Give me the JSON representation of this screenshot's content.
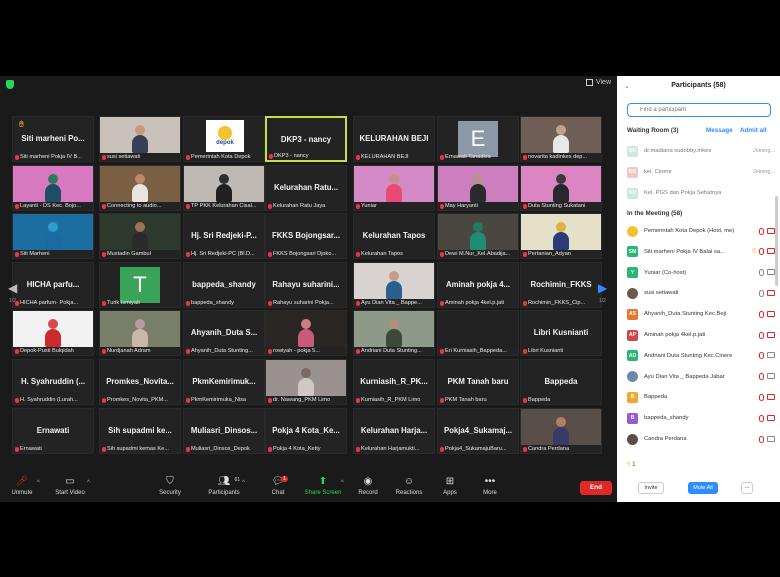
{
  "window": {
    "view_label": "View"
  },
  "tiles": [
    {
      "name": "Siti marheni Po...",
      "label": "Siti marheni Pokja IV B...",
      "style": "text",
      "hand": true
    },
    {
      "name": "",
      "label": "susi setiawati",
      "style": "video",
      "bg": "#c9c2bb",
      "skin": "#c89a78",
      "cloth": "#3a3f57"
    },
    {
      "name": "",
      "label": "Pemerintah Kota Depok",
      "style": "logo"
    },
    {
      "name": "DKP3 - nancy",
      "label": "DKP3 - nancy",
      "style": "text",
      "active": true
    },
    {
      "name": "KELURAHAN BEJI",
      "label": "KELURAHAN BEJI",
      "style": "text"
    },
    {
      "name": "E",
      "label": "Ernawati Tanadiva",
      "style": "letter",
      "letterbg": "#8c98a6"
    },
    {
      "name": "",
      "label": "novarita kadinkes dep...",
      "style": "video",
      "bg": "#6f5f56",
      "skin": "#c4a08a",
      "cloth": "#e8e8e8"
    },
    {
      "name": "",
      "label": "Layanti - DS Kec. Bojo...",
      "style": "video",
      "bg": "#d879c0",
      "skin": "#2a7a60",
      "cloth": "#1e4e66"
    },
    {
      "name": "",
      "label": "Connecting to audio...",
      "style": "video",
      "bg": "#7a5f44",
      "skin": "#b88a68",
      "cloth": "#e9e4de"
    },
    {
      "name": "",
      "label": "TP PKK Kelurahan Cisal...",
      "style": "video",
      "bg": "#bfb9b3",
      "skin": "#2d2d2d",
      "cloth": "#202020"
    },
    {
      "name": "Kelurahan Ratu...",
      "label": "Kelurahan Ratu Jaya",
      "style": "text"
    },
    {
      "name": "",
      "label": "Yuniar",
      "style": "video",
      "bg": "#d58ac8",
      "skin": "#c8918b",
      "cloth": "#e94a75"
    },
    {
      "name": "",
      "label": "May Haryanti",
      "style": "video",
      "bg": "#cc7ebf",
      "skin": "#b8928a",
      "cloth": "#2b2b2b"
    },
    {
      "name": "",
      "label": "Duta Stunting Sukatani",
      "style": "video",
      "bg": "#dc85c4",
      "skin": "#3a3a3a",
      "cloth": "#27272f"
    },
    {
      "name": "",
      "label": "Siti Marheni",
      "style": "video",
      "bg": "#1d6ea0",
      "skin": "#2f9cd0",
      "cloth": "#1b6aa3"
    },
    {
      "name": "",
      "label": "Mustadin Gambul",
      "style": "video",
      "bg": "#2d3a2d",
      "skin": "#9a7356",
      "cloth": "#2b2b2b"
    },
    {
      "name": "Hj. Sri Redjeki-P...",
      "label": "Hj. Sri Redjeki-PC (Bl.D...",
      "style": "text"
    },
    {
      "name": "FKKS Bojongsar...",
      "label": "FKKS Bojongsari Djoko...",
      "style": "text"
    },
    {
      "name": "Kelurahan Tapos",
      "label": "Kelurahan Tapos",
      "style": "text"
    },
    {
      "name": "",
      "label": "Dewi M.Nur_Kel.Abadija...",
      "style": "video",
      "bg": "#4a4640",
      "skin": "#1f7a66",
      "cloth": "#1f8c74"
    },
    {
      "name": "",
      "label": "Pertanian_Adyan",
      "style": "video",
      "bg": "#e6e0c8",
      "skin": "#d9b240",
      "cloth": "#2b3b7a"
    },
    {
      "name": "HICHA parfu...",
      "label": "HICHA parfum- Pokja...",
      "style": "text"
    },
    {
      "name": "T",
      "label": "Turik Ismiyati",
      "style": "letter",
      "letterbg": "#3aa35a"
    },
    {
      "name": "bappeda_shandy",
      "label": "bappeda_shandy",
      "style": "text"
    },
    {
      "name": "Rahayu suharini...",
      "label": "Rahayu suharini Pokja...",
      "style": "text"
    },
    {
      "name": "",
      "label": "Ayu Dian Vita _ Bappe...",
      "style": "video",
      "bg": "#d8d3d1",
      "skin": "#c89a88",
      "cloth": "#2a6090"
    },
    {
      "name": "Aminah pokja 4...",
      "label": "Aminah pokja 4kel.p.jati",
      "style": "text"
    },
    {
      "name": "Rochimin_FKKS",
      "label": "Rochimin_FKKS_Cip...",
      "style": "text"
    },
    {
      "name": "",
      "label": "Depok-Pusti Bulqidah",
      "style": "video",
      "bg": "#f2f2f2",
      "skin": "#d44a4a",
      "cloth": "#cc2b2b"
    },
    {
      "name": "",
      "label": "Nurdjanah Adram",
      "style": "video",
      "bg": "#7a7f6a",
      "skin": "#b89ca0",
      "cloth": "#c9b8a8"
    },
    {
      "name": "Ahyanih_Duta S...",
      "label": "Ahyanih_Duta Stunting...",
      "style": "text"
    },
    {
      "name": "",
      "label": "rowiyah - pokja 5...",
      "style": "video",
      "bg": "#2a2624",
      "skin": "#d27a8a",
      "cloth": "#c85a7a"
    },
    {
      "name": "",
      "label": "Andriani Duta Stunting...",
      "style": "video",
      "bg": "#8d9a8a",
      "skin": "#b0907a",
      "cloth": "#3a4a3a"
    },
    {
      "name": "",
      "label": "Eri Kurniasih_Bappeda...",
      "style": "video",
      "bg": "#212121",
      "skin": "#212121",
      "cloth": "#212121"
    },
    {
      "name": "Libri Kusnianti",
      "label": "Libri Kusnianti",
      "style": "text"
    },
    {
      "name": "H. Syahruddin (...",
      "label": "H. Syahruddin (Lurah...",
      "style": "text"
    },
    {
      "name": "Promkes_Novita...",
      "label": "Promkes_Novita_PKM...",
      "style": "text"
    },
    {
      "name": "PkmKemirimuk...",
      "label": "PkmKemirimuka_Nisa",
      "style": "text"
    },
    {
      "name": "",
      "label": "dr. Nawang_PKM Limo",
      "style": "video",
      "bg": "#9a9290",
      "skin": "#7a6a66",
      "cloth": "#cfc8c4"
    },
    {
      "name": "Kurniasih_R_PK...",
      "label": "Kurniasih_R_PKM Limo",
      "style": "text"
    },
    {
      "name": "PKM Tanah baru",
      "label": "PKM Tanah baru",
      "style": "text"
    },
    {
      "name": "Bappeda",
      "label": "Bappeda",
      "style": "text"
    },
    {
      "name": "Ernawati",
      "label": "Ernawati",
      "style": "text"
    },
    {
      "name": "Sih supadmi ke...",
      "label": "Sih supadmi kemas Ke...",
      "style": "text"
    },
    {
      "name": "Muliasri_Dinsos...",
      "label": "Muliasri_Dinsos_Depok",
      "style": "text"
    },
    {
      "name": "Pokja 4 Kota_Ke...",
      "label": "Pokja 4 Kota_Ketty",
      "style": "text"
    },
    {
      "name": "Kelurahan Harja...",
      "label": "Kelurahan Harjamukti...",
      "style": "text"
    },
    {
      "name": "Pokja4_Sukamaj...",
      "label": "Pokja4_SukamajuBaru...",
      "style": "text"
    },
    {
      "name": "",
      "label": "Candra Perdana",
      "style": "video",
      "bg": "#5a4f48",
      "skin": "#b08062",
      "cloth": "#3a3a6a"
    }
  ],
  "logo_text": "depok",
  "page": {
    "left": "1/2",
    "right": "1/2"
  },
  "toolbar": {
    "unmute": "Unmute",
    "start_video": "Start Video",
    "security": "Security",
    "participants": "Participants",
    "participants_count": "61",
    "chat": "Chat",
    "chat_badge": "1",
    "share_screen": "Share Screen",
    "record": "Record",
    "reactions": "Reactions",
    "apps": "Apps",
    "more": "More",
    "end": "End"
  },
  "panel": {
    "title": "Participants (58)",
    "search_placeholder": "Find a participant",
    "waiting_room": "Waiting Room (3)",
    "message": "Message",
    "admit_all": "Admit all",
    "waiting": [
      {
        "initials": "DR",
        "name": "dr.madiana sudobby.mkes",
        "status": "Joining...",
        "color": "#cfe8d8"
      },
      {
        "initials": "KC",
        "name": "kel. Cinere",
        "status": "Joining...",
        "color": "#f1c7c7"
      },
      {
        "initials": "KP",
        "name": "Kel. PGS dan Pokja Sehatnya",
        "status": "",
        "color": "#cfe8d8"
      }
    ],
    "in_meeting": "In the Meeting (58)",
    "members": [
      {
        "initials": "",
        "name": "Pemerintah Kota Depok (Host, me)",
        "color": "#f2c230",
        "mic": "muted",
        "cam": "off",
        "hand": false,
        "photo": true
      },
      {
        "initials": "SM",
        "name": "Siti marheni Pokja IV Balai sa...",
        "color": "#2bb673",
        "mic": "muted",
        "cam": "off",
        "hand": true
      },
      {
        "initials": "Y",
        "name": "Yuniar (Co-host)",
        "color": "#2bb673",
        "mic": "on",
        "cam": "on",
        "hand": false
      },
      {
        "initials": "",
        "name": "susi setiawati",
        "color": "#6a5a4a",
        "mic": "on",
        "cam": "off",
        "hand": false,
        "photo": true
      },
      {
        "initials": "AS",
        "name": "Ahyanih_Duta Stunting Kec.Beji",
        "color": "#e8772e",
        "mic": "muted",
        "cam": "off",
        "hand": false
      },
      {
        "initials": "AP",
        "name": "Aminah pokja 4kel.p.jati",
        "color": "#d64545",
        "mic": "muted",
        "cam": "off",
        "hand": false
      },
      {
        "initials": "AD",
        "name": "Andriani Duta Stunting Kec.Cinere",
        "color": "#2bb673",
        "mic": "muted",
        "cam": "on",
        "hand": false
      },
      {
        "initials": "",
        "name": "Ayu Dian Vita _ Bappeda Jabar",
        "color": "#6a8aa8",
        "mic": "muted",
        "cam": "on",
        "hand": false,
        "photo": true
      },
      {
        "initials": "B",
        "name": "Bappeda",
        "color": "#f2a82e",
        "mic": "muted",
        "cam": "off",
        "hand": false
      },
      {
        "initials": "B",
        "name": "bappeda_shandy",
        "color": "#9b59d0",
        "mic": "muted",
        "cam": "off",
        "hand": false
      },
      {
        "initials": "",
        "name": "Candra Perdana",
        "color": "#5a4f48",
        "mic": "muted",
        "cam": "on",
        "hand": false,
        "photo": true
      }
    ],
    "raised_count": "1",
    "invite": "Invite",
    "mute_all": "Mute All",
    "more": "..."
  }
}
